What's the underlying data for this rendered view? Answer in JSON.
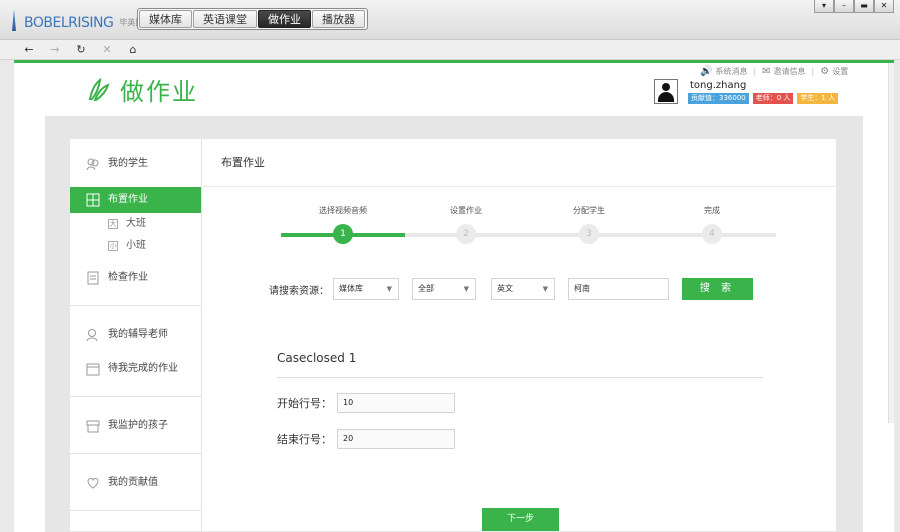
{
  "app": {
    "logo_text": "BOBELRISING",
    "logo_sub": "毕英团副",
    "logo_sub2": "英格"
  },
  "nav": {
    "tabs": [
      {
        "label": "媒体库"
      },
      {
        "label": "英语课堂"
      },
      {
        "label": "做作业",
        "active": true
      },
      {
        "label": "播放器"
      }
    ]
  },
  "window_controls": [
    "▾",
    "–",
    "▬",
    "✕"
  ],
  "toolbar_icons": [
    "back-arrow-icon",
    "forward-arrow-icon",
    "refresh-icon",
    "stop-icon",
    "home-icon"
  ],
  "header": {
    "title": "做作业",
    "links": {
      "messages": "系统消息",
      "invites": "邀请信息",
      "settings": "设置"
    },
    "user": {
      "name": "tong.zhang",
      "contribution": "贡献值：336000",
      "teachers": "老师：0 人",
      "students": "学生：1 人"
    }
  },
  "sidebar": {
    "my_students": "我的学生",
    "assign": "布置作业",
    "class_big": "大班",
    "class_small": "小班",
    "check": "检查作业",
    "my_tutors": "我的辅导老师",
    "pending": "待我完成的作业",
    "children": "我监护的孩子",
    "contribution": "我的贡献值",
    "colors": {
      "active": "#3ab34a"
    }
  },
  "main": {
    "title": "布置作业",
    "steps": [
      {
        "label": "选择视频音频",
        "num": "1"
      },
      {
        "label": "设置作业",
        "num": "2"
      },
      {
        "label": "分配学生",
        "num": "3"
      },
      {
        "label": "完成",
        "num": "4"
      }
    ],
    "current_step": 1,
    "search": {
      "label": "请搜索资源：",
      "library": "媒体库",
      "category": "全部",
      "language": "英文",
      "keyword": "柯南",
      "button": "搜 索"
    },
    "result_title": "Caseclosed 1",
    "start_label": "开始行号：",
    "start_value": "10",
    "end_label": "结束行号：",
    "end_value": "20",
    "next_button": "下一步"
  }
}
